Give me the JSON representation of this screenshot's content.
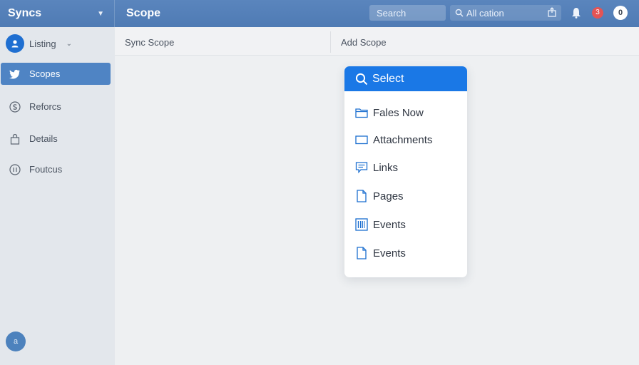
{
  "header": {
    "app_title": "Syncs",
    "page_title": "Scope",
    "search_placeholder": "Search",
    "notification_field": "All cation",
    "notification_badge": "3",
    "profile_badge": "0"
  },
  "sidebar": {
    "user_label": "Listing",
    "items": [
      {
        "label": "Scopes",
        "icon": "bird-icon",
        "active": true
      },
      {
        "label": "Reforcs",
        "icon": "currency-icon",
        "active": false
      },
      {
        "label": "Details",
        "icon": "bag-icon",
        "active": false
      },
      {
        "label": "Foutcus",
        "icon": "gauge-icon",
        "active": false
      }
    ],
    "bottom_icon_label": "a"
  },
  "content": {
    "left_column": "Sync Scope",
    "right_column": "Add Scope"
  },
  "dropdown": {
    "title": "Select",
    "items": [
      {
        "label": "Fales Now",
        "icon": "folder-icon"
      },
      {
        "label": "Attachments",
        "icon": "window-icon"
      },
      {
        "label": "Links",
        "icon": "comment-icon"
      },
      {
        "label": "Pages",
        "icon": "file-icon"
      },
      {
        "label": "Events",
        "icon": "barcode-icon"
      },
      {
        "label": "Events",
        "icon": "document-icon"
      }
    ]
  },
  "colors": {
    "topbar": "#5a85bd",
    "accent": "#1a78e6",
    "sidebar_active": "#4f84c4",
    "badge_red": "#e45454"
  }
}
